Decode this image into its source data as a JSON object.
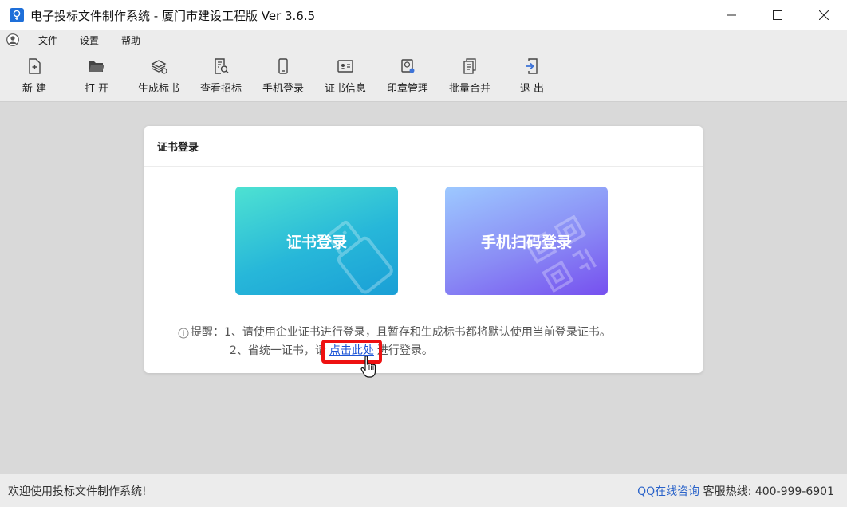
{
  "window": {
    "title": "电子投标文件制作系统 - 厦门市建设工程版 Ver 3.6.5"
  },
  "menu": {
    "items": [
      "文件",
      "设置",
      "帮助"
    ]
  },
  "toolbar": {
    "items": [
      {
        "label": "新 建",
        "icon": "new-file-icon"
      },
      {
        "label": "打 开",
        "icon": "folder-open-icon"
      },
      {
        "label": "生成标书",
        "icon": "generate-bid-icon"
      },
      {
        "label": "查看招标",
        "icon": "view-tender-icon"
      },
      {
        "label": "手机登录",
        "icon": "phone-icon"
      },
      {
        "label": "证书信息",
        "icon": "certificate-icon"
      },
      {
        "label": "印章管理",
        "icon": "seal-icon"
      },
      {
        "label": "批量合并",
        "icon": "merge-icon"
      },
      {
        "label": "退 出",
        "icon": "exit-icon"
      }
    ]
  },
  "panel": {
    "title": "证书登录",
    "cards": {
      "cert": "证书登录",
      "phone": "手机扫码登录"
    },
    "tip": {
      "prefix": "提醒：",
      "line1": "1、请使用企业证书进行登录，且暂存和生成标书都将默认使用当前登录证书。",
      "line2_before": "2、省统一证书，请",
      "link": "点击此处",
      "line2_after": "进行登录。"
    }
  },
  "status": {
    "welcome": "欢迎使用投标文件制作系统!",
    "qq": "QQ在线咨询",
    "hotline_label": "客服热线:",
    "hotline": "400-999-6901"
  },
  "colors": {
    "cert_card": "#27b7d9",
    "phone_card": "#8a8cf5",
    "link": "#1c55d6",
    "highlight": "#ee1111"
  }
}
